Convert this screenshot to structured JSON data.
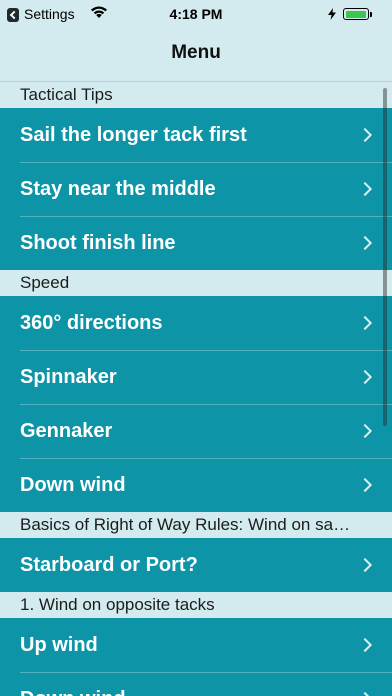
{
  "status_bar": {
    "back_app": "Settings",
    "time": "4:18 PM",
    "battery_level": 0.9
  },
  "nav": {
    "title": "Menu"
  },
  "sections": [
    {
      "header": "Tactical Tips",
      "items": [
        {
          "label": "Sail the longer tack first"
        },
        {
          "label": "Stay near the middle"
        },
        {
          "label": "Shoot finish line"
        }
      ]
    },
    {
      "header": "Speed",
      "items": [
        {
          "label": "360° directions"
        },
        {
          "label": "Spinnaker"
        },
        {
          "label": "Gennaker"
        },
        {
          "label": "Down wind"
        }
      ]
    },
    {
      "header": "Basics of Right of Way Rules: Wind on same tack",
      "items": [
        {
          "label": "Starboard or Port?"
        }
      ]
    },
    {
      "header": "1. Wind on opposite tacks",
      "items": [
        {
          "label": "Up wind"
        },
        {
          "label": "Down wind"
        }
      ]
    }
  ],
  "colors": {
    "row_background": "#0d94a7",
    "header_background": "#d3ebee",
    "battery": "#3ec54b"
  },
  "icons": [
    "back-arrow-icon",
    "wifi-icon",
    "charging-icon",
    "battery-icon",
    "chevron-right-icon"
  ]
}
